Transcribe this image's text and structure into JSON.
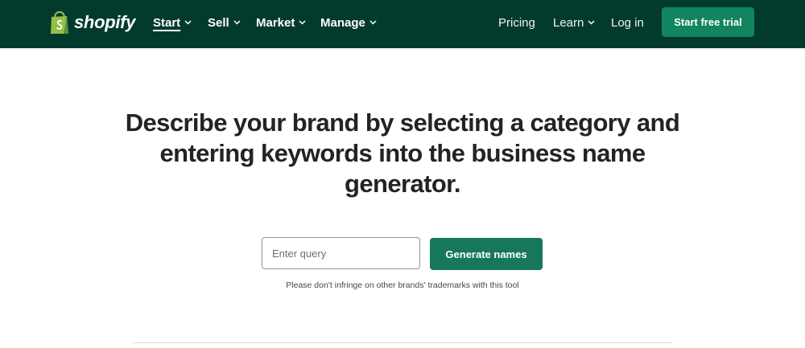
{
  "brand": {
    "wordmark": "shopify",
    "logo_icon": "shopping-bag-icon",
    "logo_color": "#95bf47"
  },
  "nav": {
    "items": [
      {
        "label": "Start",
        "active": true,
        "has_dropdown": true
      },
      {
        "label": "Sell",
        "has_dropdown": true
      },
      {
        "label": "Market",
        "has_dropdown": true
      },
      {
        "label": "Manage",
        "has_dropdown": true
      }
    ],
    "right_items": [
      {
        "label": "Pricing"
      },
      {
        "label": "Learn",
        "has_dropdown": true
      },
      {
        "label": "Log in"
      }
    ],
    "cta_label": "Start free trial",
    "background": "#023b2e",
    "accent": "#12845f"
  },
  "main": {
    "headline": "Describe your brand by selecting a category and entering keywords into the business name generator.",
    "query": {
      "placeholder": "Enter query",
      "value": ""
    },
    "generate_label": "Generate names",
    "disclaimer": "Please don't infringe on other brands' trademarks with this tool"
  }
}
